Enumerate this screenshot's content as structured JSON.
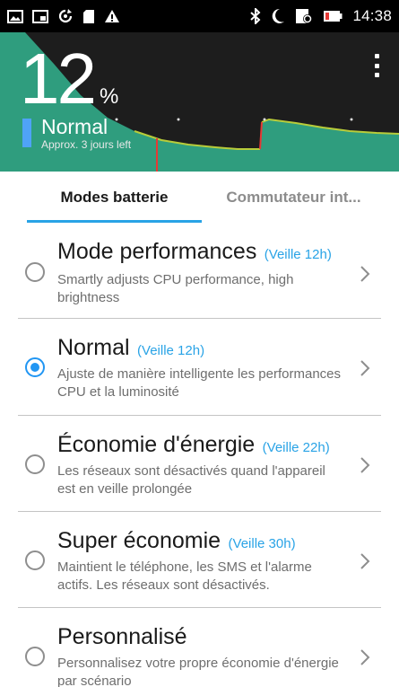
{
  "status_bar": {
    "left_icons": [
      "image-notification-icon",
      "cast-icon",
      "sync-icon",
      "sd-card-icon",
      "warning-icon"
    ],
    "right_icons": [
      "bluetooth-icon",
      "do-not-disturb-moon-icon",
      "battery-saver-icon",
      "battery-icon"
    ],
    "time": "14:38"
  },
  "header": {
    "percent_value": "12",
    "percent_unit": "%",
    "mode_name": "Normal",
    "approx_text": "Approx. 3 jours left",
    "battery_level": 0.12,
    "colors": {
      "graph_fill": "#2f9d7e",
      "graph_line": "#b8cc3a",
      "mode_bar": "#4fa3f7",
      "background": "#1d1d1d"
    }
  },
  "tabs": [
    {
      "label": "Modes batterie",
      "active": true
    },
    {
      "label": "Commutateur int...",
      "active": false
    }
  ],
  "modes": [
    {
      "title": "Mode performances",
      "standby": "(Veille 12h)",
      "description": "Smartly adjusts CPU performance, high brightness",
      "selected": false
    },
    {
      "title": "Normal",
      "standby": "(Veille 12h)",
      "description": "Ajuste de manière intelligente les performances CPU et la luminosité",
      "selected": true
    },
    {
      "title": "Économie d'énergie",
      "standby": "(Veille 22h)",
      "description": "Les réseaux sont désactivés quand l'appareil est en veille prolongée",
      "selected": false
    },
    {
      "title": "Super économie",
      "standby": "(Veille 30h)",
      "description": "Maintient le téléphone, les SMS et l'alarme actifs. Les réseaux sont désactivés.",
      "selected": false
    },
    {
      "title": "Personnalisé",
      "standby": "",
      "description": "Personnalisez votre propre économie d'énergie par scénario",
      "selected": false
    }
  ],
  "accent_color": "#29a3e6"
}
